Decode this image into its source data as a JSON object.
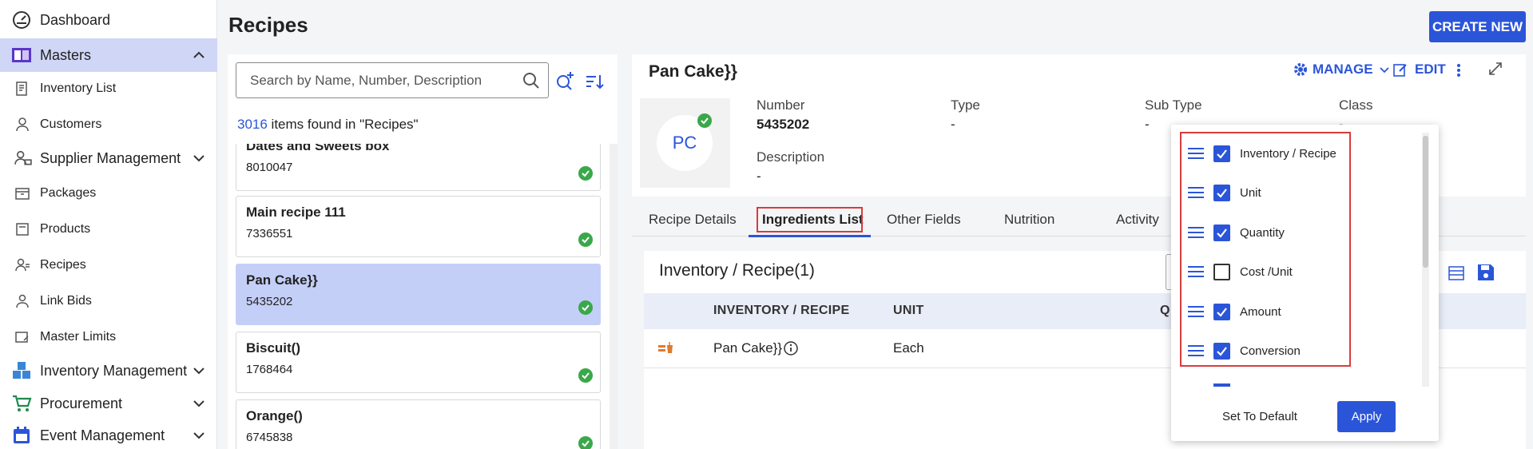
{
  "sidebar": {
    "items": [
      {
        "label": "Dashboard",
        "icon": "gauge-icon"
      },
      {
        "label": "Masters",
        "icon": "book-icon",
        "expanded": true
      },
      {
        "label": "Inventory List",
        "icon": "inventory-icon"
      },
      {
        "label": "Customers",
        "icon": "person-icon"
      },
      {
        "label": "Supplier Management",
        "icon": "supplier-icon"
      },
      {
        "label": "Packages",
        "icon": "package-icon"
      },
      {
        "label": "Products",
        "icon": "product-icon"
      },
      {
        "label": "Recipes",
        "icon": "recipe-person-icon"
      },
      {
        "label": "Link Bids",
        "icon": "link-bid-icon"
      },
      {
        "label": "Master Limits",
        "icon": "limits-icon"
      },
      {
        "label": "Inventory Management",
        "icon": "boxes-icon"
      },
      {
        "label": "Procurement",
        "icon": "cart-icon"
      },
      {
        "label": "Event Management",
        "icon": "calendar-icon"
      }
    ]
  },
  "header": {
    "title": "Recipes",
    "create_label": "CREATE NEW"
  },
  "search": {
    "placeholder": "Search by Name, Number, Description"
  },
  "results": {
    "count": "3016",
    "suffix": " items found in \"Recipes\""
  },
  "list": [
    {
      "name": "Dates and Sweets box",
      "code": "8010047"
    },
    {
      "name": "Main recipe 111",
      "code": "7336551"
    },
    {
      "name": "Pan Cake}}",
      "code": "5435202"
    },
    {
      "name": "Biscuit()",
      "code": "1768464"
    },
    {
      "name": "Orange()",
      "code": "6745838"
    }
  ],
  "detail": {
    "title": "Pan Cake}}",
    "manage_label": "MANAGE",
    "edit_label": "EDIT",
    "avatar_initials": "PC",
    "fields": {
      "number_label": "Number",
      "number_value": "5435202",
      "type_label": "Type",
      "type_value": "-",
      "subtype_label": "Sub Type",
      "subtype_value": "-",
      "class_label": "Class",
      "class_value": "-",
      "description_label": "Description",
      "description_value": "-"
    }
  },
  "tabs": [
    "Recipe Details",
    "Ingredients List",
    "Other Fields",
    "Nutrition",
    "Activity"
  ],
  "ingredients": {
    "title": "Inventory / Recipe(1)",
    "columns": [
      "INVENTORY / RECIPE",
      "UNIT",
      "Q"
    ],
    "rows": [
      {
        "item": "Pan Cake}}",
        "unit": "Each"
      }
    ]
  },
  "column_popup": {
    "options": [
      {
        "label": "Inventory / Recipe",
        "checked": true
      },
      {
        "label": "Unit",
        "checked": true
      },
      {
        "label": "Quantity",
        "checked": true
      },
      {
        "label": "Cost /Unit",
        "checked": false
      },
      {
        "label": "Amount",
        "checked": true
      },
      {
        "label": "Conversion",
        "checked": true
      }
    ],
    "set_default_label": "Set To Default",
    "apply_label": "Apply"
  },
  "colors": {
    "accent": "#2b55d9",
    "selected": "#c4cff7",
    "success": "#3aa84a",
    "highlight": "#d93b3b"
  }
}
